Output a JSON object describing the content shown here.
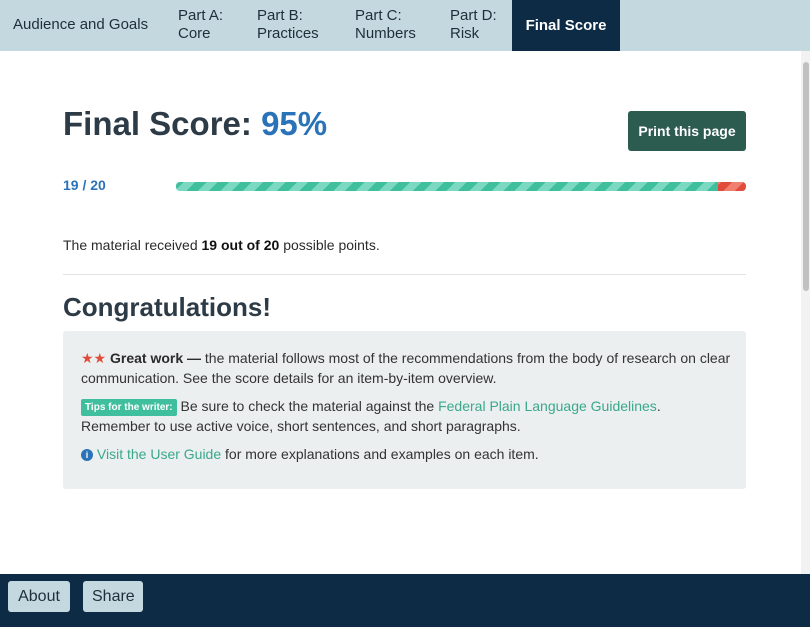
{
  "nav": {
    "tabs": [
      {
        "line1": "Audience and Goals",
        "line2": ""
      },
      {
        "line1": "Part A:",
        "line2": "Core"
      },
      {
        "line1": "Part B:",
        "line2": "Practices"
      },
      {
        "line1": "Part C:",
        "line2": "Numbers"
      },
      {
        "line1": "Part D:",
        "line2": "Risk"
      },
      {
        "line1": "Final Score",
        "line2": ""
      }
    ],
    "active_tab": "Final Score",
    "active_color": "#0d2b45"
  },
  "main": {
    "heading_label": "Final Score:",
    "heading_percent": "95%",
    "print_button": "Print this page",
    "fraction": "19 / 20",
    "progress": {
      "score": 19,
      "total": 20
    },
    "received": {
      "prefix": "The material received",
      "points": "19 out of 20",
      "suffix": "possible points."
    },
    "congrats": "Congratulations!",
    "panel": {
      "stars": "★★",
      "great_work": "Great work —",
      "line1_text": "the material follows most of the recommendations from the body of research on clear communication. See the score details for an item-by-item overview.",
      "tips_badge": "Tips for the writer:",
      "tips_text": "Be sure to check the material against the",
      "tips_link": "Federal Plain Language Guidelines",
      "tips_text2": ". Remember to use active voice, short sentences, and short paragraphs.",
      "info_icon": "i",
      "guide_link": "Visit the User Guide",
      "guide_text": "for more explanations and examples on each item."
    }
  },
  "footer": {
    "about": "About",
    "share": "Share"
  },
  "colors": {
    "accent_blue": "#2a73b8",
    "green": "#3fbf9e",
    "red": "#e04b3b",
    "navy": "#0d2b45"
  }
}
